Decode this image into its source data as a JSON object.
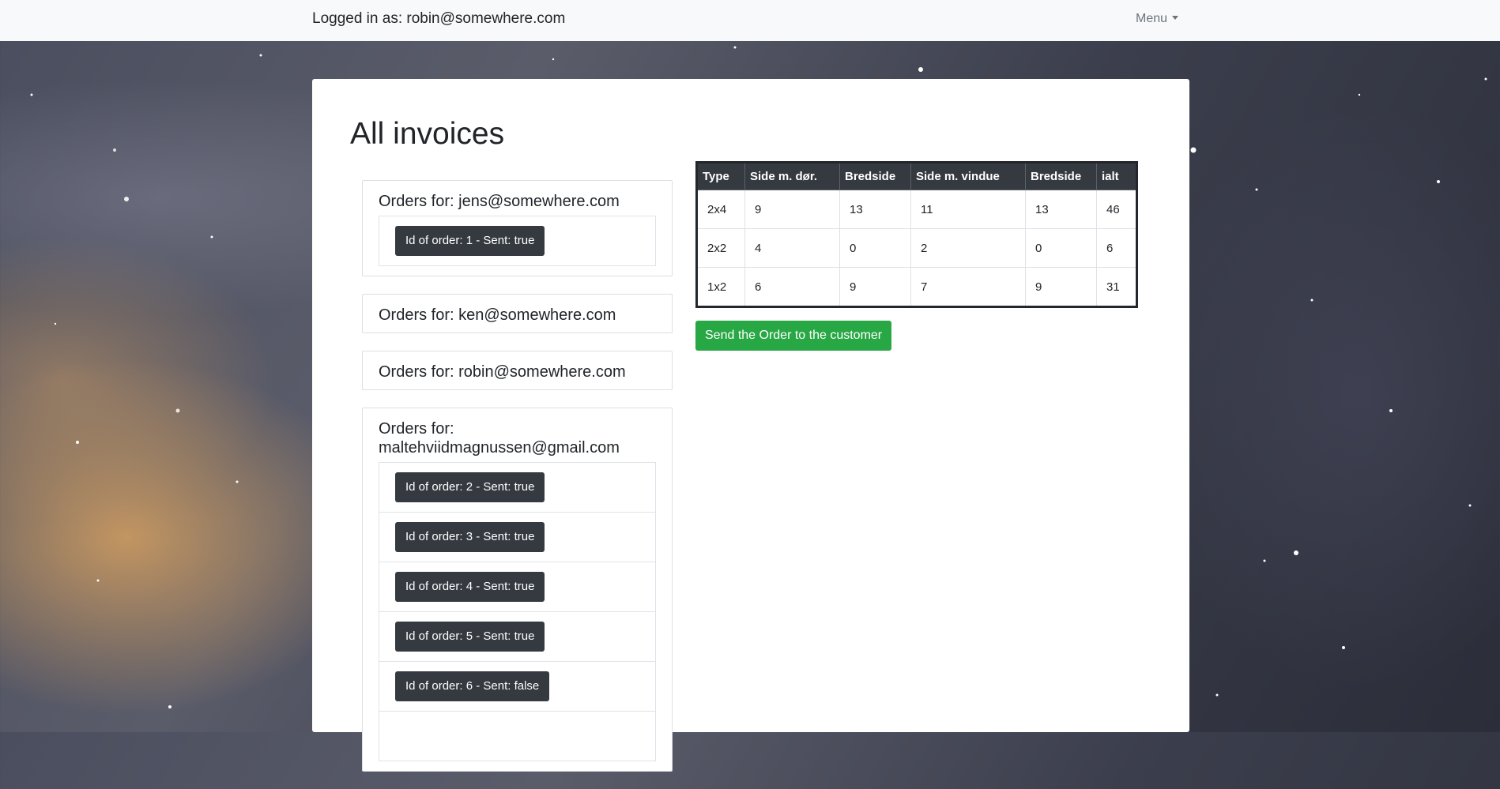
{
  "navbar": {
    "login_text": "Logged in as: robin@somewhere.com",
    "menu_label": "Menu"
  },
  "page": {
    "title": "All invoices"
  },
  "customers": [
    {
      "title": "Orders for: jens@somewhere.com",
      "orders": [
        "Id of order: 1 - Sent: true"
      ]
    },
    {
      "title": "Orders for: ken@somewhere.com",
      "orders": []
    },
    {
      "title": "Orders for: robin@somewhere.com",
      "orders": []
    },
    {
      "title_line1": "Orders for:",
      "title_line2": "maltehviidmagnussen@gmail.com",
      "orders": [
        "Id of order: 2 - Sent: true",
        "Id of order: 3 - Sent: true",
        "Id of order: 4 - Sent: true",
        "Id of order: 5 - Sent: true",
        "Id of order: 6 - Sent: false"
      ]
    }
  ],
  "order_table": {
    "headers": [
      "Type",
      "Side m. dør.",
      "Bredside",
      "Side m. vindue",
      "Bredside",
      "ialt"
    ],
    "rows": [
      [
        "2x4",
        "9",
        "13",
        "11",
        "13",
        "46"
      ],
      [
        "2x2",
        "4",
        "0",
        "2",
        "0",
        "6"
      ],
      [
        "1x2",
        "6",
        "9",
        "7",
        "9",
        "31"
      ]
    ]
  },
  "send_button_label": "Send the Order to the customer",
  "colors": {
    "navbar_bg": "#f8f9fa",
    "dark_button": "#343a40",
    "send_button": "#28a745",
    "table_header": "#343a40"
  }
}
